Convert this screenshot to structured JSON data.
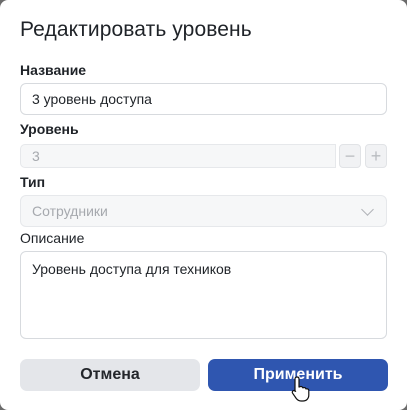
{
  "dialog": {
    "title": "Редактировать уровень",
    "name_label": "Название",
    "name_value": "3 уровень доступа",
    "level_label": "Уровень",
    "level_value": "3",
    "type_label": "Тип",
    "type_value": "Сотрудники",
    "description_label": "Описание",
    "description_value": "Уровень доступа для техников",
    "cancel_label": "Отмена",
    "apply_label": "Применить",
    "minus_glyph": "−",
    "plus_glyph": "+"
  },
  "colors": {
    "primary": "#2f56b0",
    "secondary_button": "#e4e6ea"
  },
  "icons": [
    "minus-icon",
    "plus-icon",
    "chevron-down-icon",
    "pointer-cursor-icon"
  ]
}
